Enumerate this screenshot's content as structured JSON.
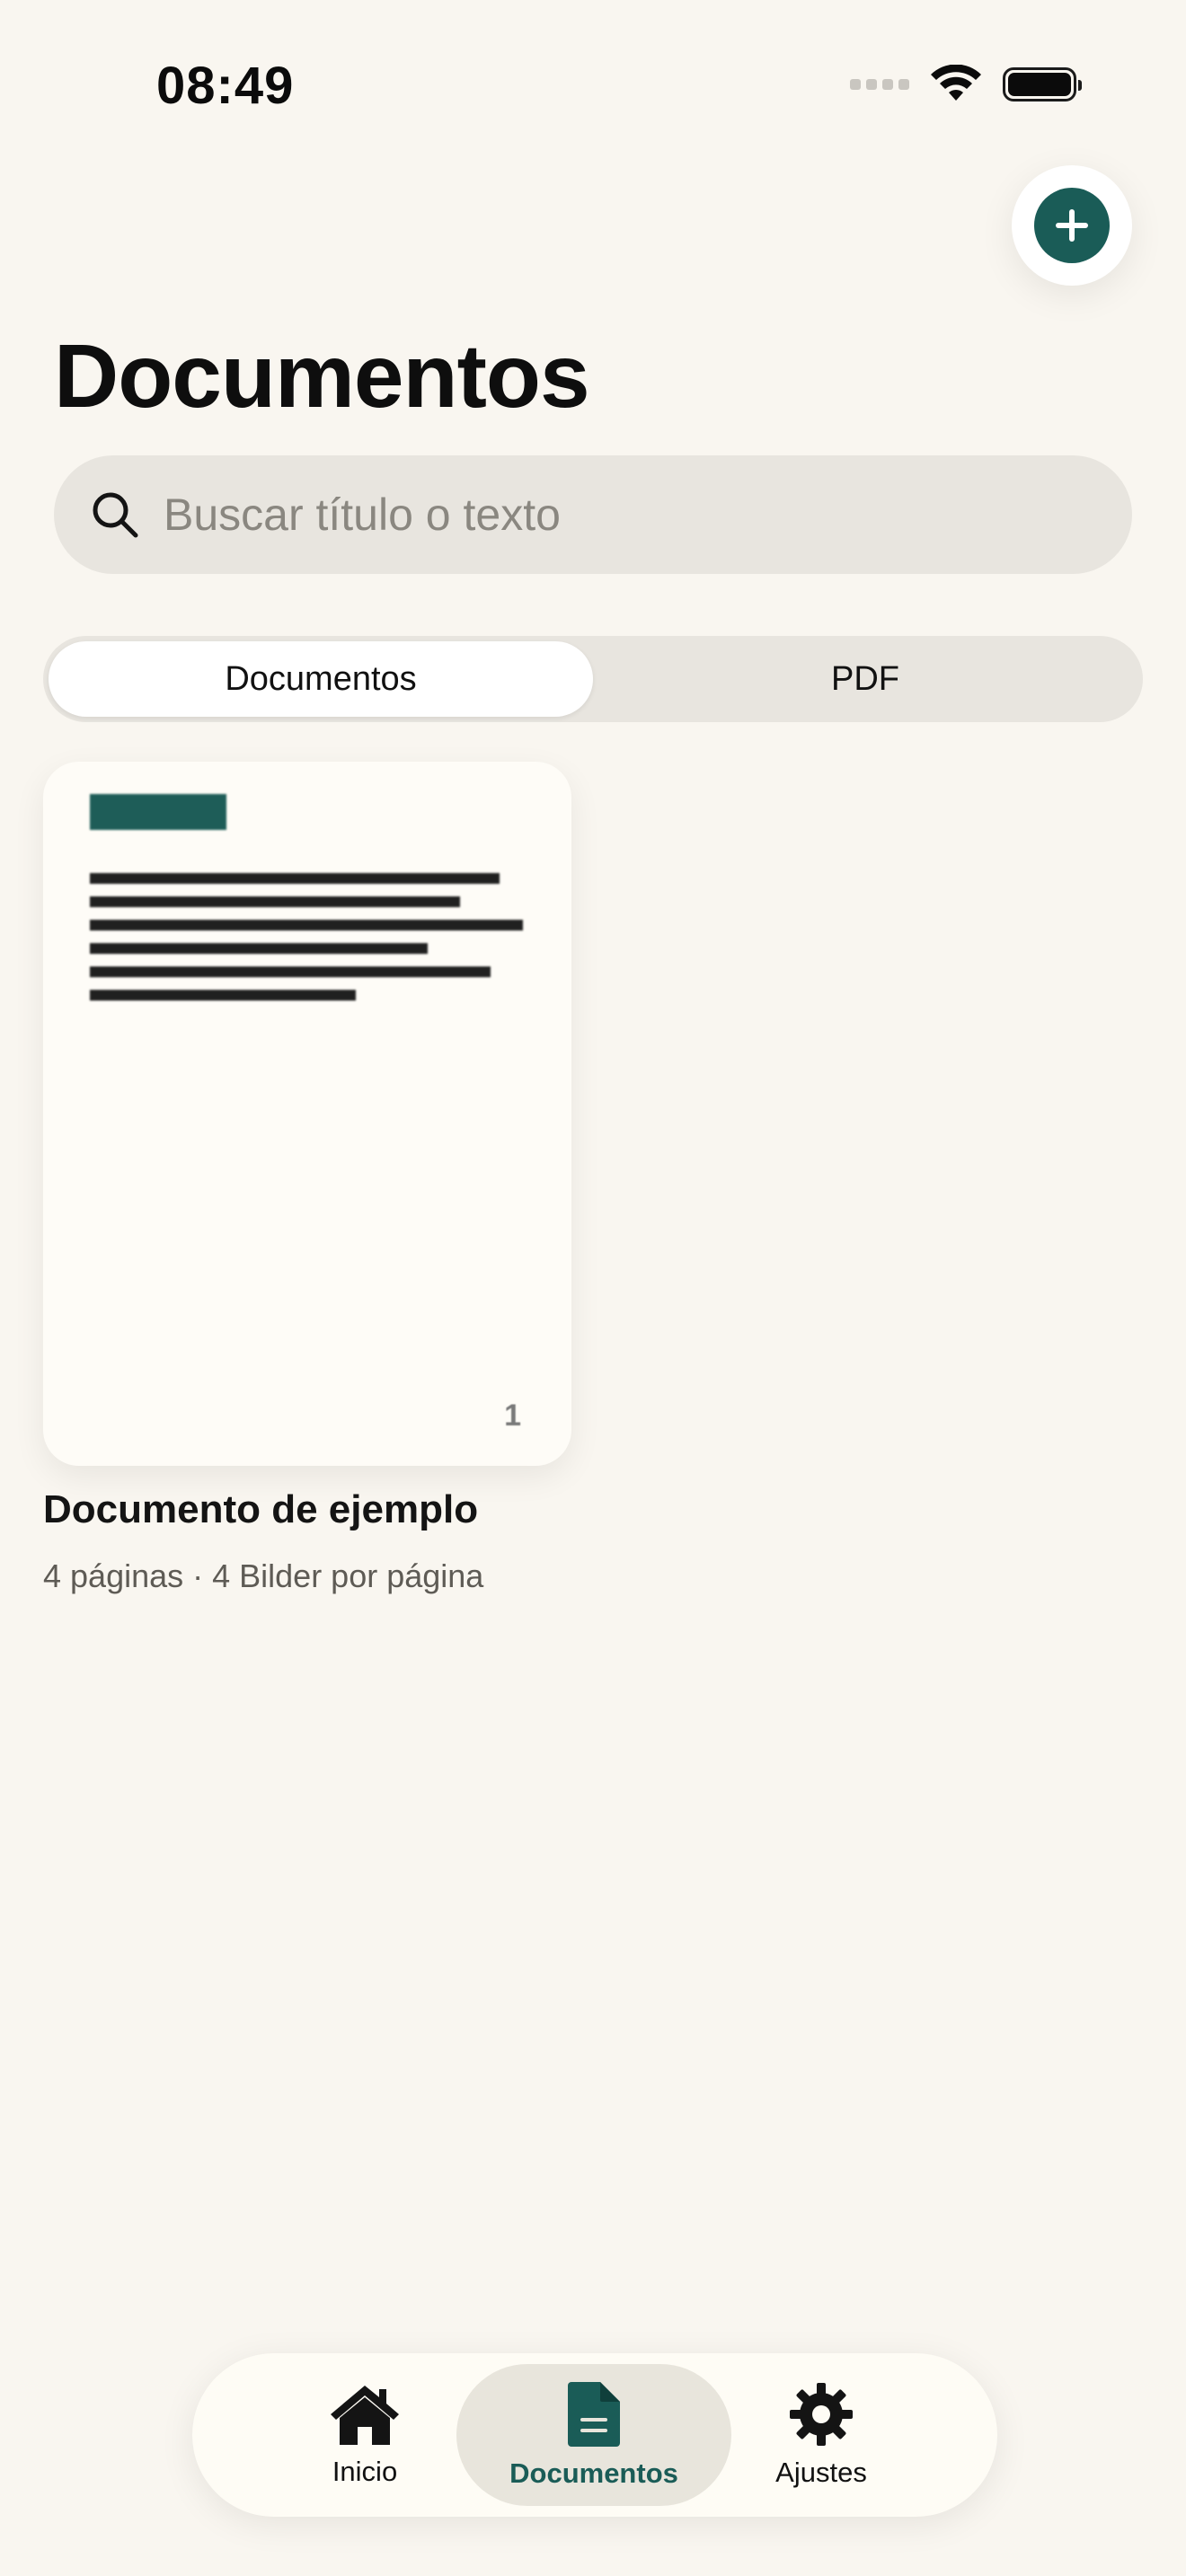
{
  "status_bar": {
    "time": "08:49"
  },
  "header": {
    "title": "Documentos",
    "add_icon": "plus-icon"
  },
  "search": {
    "placeholder": "Buscar título o texto",
    "icon": "search-icon"
  },
  "segmented": {
    "items": [
      {
        "label": "Documentos",
        "active": true
      },
      {
        "label": "PDF",
        "active": false
      }
    ]
  },
  "documents": [
    {
      "title": "Documento de ejemplo",
      "meta": "4 páginas · 4 Bilder por página",
      "thumbnail_page_number": "1"
    }
  ],
  "tabbar": {
    "items": [
      {
        "label": "Inicio",
        "icon": "home-icon",
        "active": false
      },
      {
        "label": "Documentos",
        "icon": "document-icon",
        "active": true
      },
      {
        "label": "Ajustes",
        "icon": "gear-icon",
        "active": false
      }
    ]
  },
  "colors": {
    "background": "#f9f6f0",
    "accent": "#1a5c57",
    "search_bg": "#e8e5df"
  }
}
